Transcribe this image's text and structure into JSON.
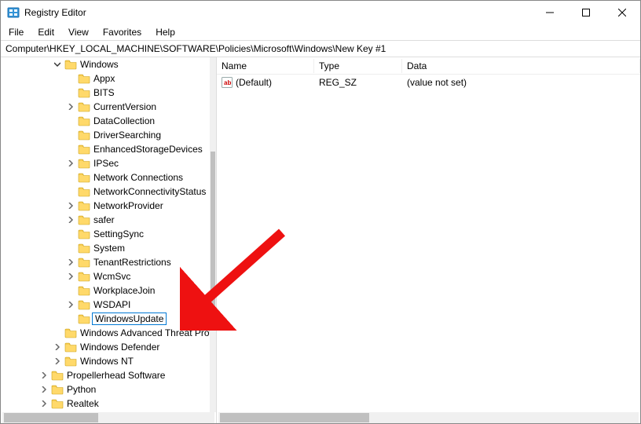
{
  "window": {
    "title": "Registry Editor"
  },
  "menu": {
    "file": "File",
    "edit": "Edit",
    "view": "View",
    "favorites": "Favorites",
    "help": "Help"
  },
  "address": "Computer\\HKEY_LOCAL_MACHINE\\SOFTWARE\\Policies\\Microsoft\\Windows\\New Key #1",
  "list": {
    "headers": {
      "name": "Name",
      "type": "Type",
      "data": "Data"
    },
    "rows": [
      {
        "name": "(Default)",
        "type": "REG_SZ",
        "data": "(value not set)"
      }
    ]
  },
  "tree": [
    {
      "indent": 5,
      "label": "Windows",
      "exp": "open"
    },
    {
      "indent": 6,
      "label": "Appx",
      "exp": "none"
    },
    {
      "indent": 6,
      "label": "BITS",
      "exp": "none"
    },
    {
      "indent": 6,
      "label": "CurrentVersion",
      "exp": "closed"
    },
    {
      "indent": 6,
      "label": "DataCollection",
      "exp": "none"
    },
    {
      "indent": 6,
      "label": "DriverSearching",
      "exp": "none"
    },
    {
      "indent": 6,
      "label": "EnhancedStorageDevices",
      "exp": "none"
    },
    {
      "indent": 6,
      "label": "IPSec",
      "exp": "closed"
    },
    {
      "indent": 6,
      "label": "Network Connections",
      "exp": "none"
    },
    {
      "indent": 6,
      "label": "NetworkConnectivityStatus",
      "exp": "none"
    },
    {
      "indent": 6,
      "label": "NetworkProvider",
      "exp": "closed"
    },
    {
      "indent": 6,
      "label": "safer",
      "exp": "closed"
    },
    {
      "indent": 6,
      "label": "SettingSync",
      "exp": "none"
    },
    {
      "indent": 6,
      "label": "System",
      "exp": "none"
    },
    {
      "indent": 6,
      "label": "TenantRestrictions",
      "exp": "closed"
    },
    {
      "indent": 6,
      "label": "WcmSvc",
      "exp": "closed"
    },
    {
      "indent": 6,
      "label": "WorkplaceJoin",
      "exp": "none"
    },
    {
      "indent": 6,
      "label": "WSDAPI",
      "exp": "closed"
    },
    {
      "indent": 6,
      "label": "WindowsUpdate",
      "exp": "none",
      "editing": true
    },
    {
      "indent": 5,
      "label": "Windows Advanced Threat Protection",
      "exp": "none"
    },
    {
      "indent": 5,
      "label": "Windows Defender",
      "exp": "closed"
    },
    {
      "indent": 5,
      "label": "Windows NT",
      "exp": "closed"
    },
    {
      "indent": 4,
      "label": "Propellerhead Software",
      "exp": "closed"
    },
    {
      "indent": 4,
      "label": "Python",
      "exp": "closed"
    },
    {
      "indent": 4,
      "label": "Realtek",
      "exp": "closed"
    }
  ]
}
